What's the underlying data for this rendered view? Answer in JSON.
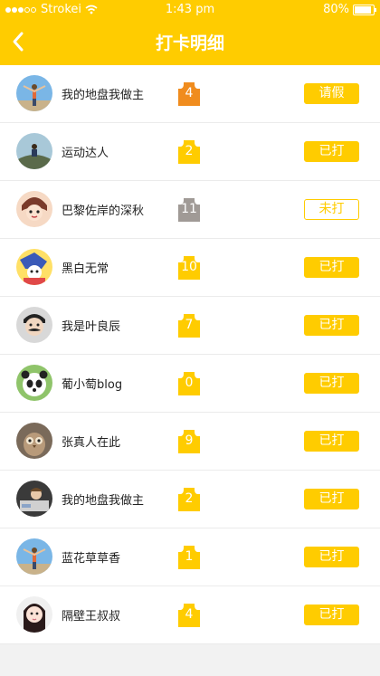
{
  "status_bar": {
    "carrier": "Strokei",
    "time": "1:43 pm",
    "battery": "80%"
  },
  "header": {
    "title": "打卡明细"
  },
  "colors": {
    "accent": "#ffcc00",
    "jersey_default": "#ffcc00",
    "jersey_orange": "#f08c1e",
    "jersey_gray": "#a09a96"
  },
  "rows": [
    {
      "name": "我的地盘我做主",
      "number": "4",
      "jersey_color": "#f08c1e",
      "action": "请假",
      "style": "filled",
      "avatar": "person-arms-spread"
    },
    {
      "name": "运动达人",
      "number": "2",
      "jersey_color": "#ffcc00",
      "action": "已打",
      "style": "filled",
      "avatar": "person-on-rock"
    },
    {
      "name": "巴黎佐岸的深秋",
      "number": "11",
      "jersey_color": "#a09a96",
      "action": "未打",
      "style": "outline",
      "avatar": "cartoon-face"
    },
    {
      "name": "黑白无常",
      "number": "10",
      "jersey_color": "#ffcc00",
      "action": "已打",
      "style": "filled",
      "avatar": "anime-character"
    },
    {
      "name": "我是叶良辰",
      "number": "7",
      "jersey_color": "#ffcc00",
      "action": "已打",
      "style": "filled",
      "avatar": "mustache-face"
    },
    {
      "name": "葡小萄blog",
      "number": "0",
      "jersey_color": "#ffcc00",
      "action": "已打",
      "style": "filled",
      "avatar": "panda"
    },
    {
      "name": "张真人在此",
      "number": "9",
      "jersey_color": "#ffcc00",
      "action": "已打",
      "style": "filled",
      "avatar": "owl"
    },
    {
      "name": "我的地盘我做主",
      "number": "2",
      "jersey_color": "#ffcc00",
      "action": "已打",
      "style": "filled",
      "avatar": "person-in-vehicle"
    },
    {
      "name": "蓝花草草香",
      "number": "1",
      "jersey_color": "#ffcc00",
      "action": "已打",
      "style": "filled",
      "avatar": "person-arms-spread"
    },
    {
      "name": "隔壁王叔叔",
      "number": "4",
      "jersey_color": "#ffcc00",
      "action": "已打",
      "style": "filled",
      "avatar": "girl-portrait"
    }
  ]
}
